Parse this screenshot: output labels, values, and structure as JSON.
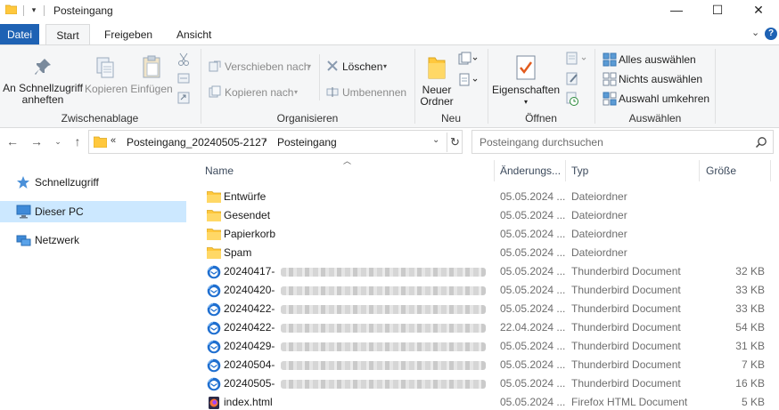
{
  "titlebar": {
    "title": "Posteingang",
    "qa_dropdown": "▾",
    "minimize": "—",
    "maximize": "☐",
    "close": "✕"
  },
  "tabs": [
    {
      "label": "Datei"
    },
    {
      "label": "Start"
    },
    {
      "label": "Freigeben"
    },
    {
      "label": "Ansicht"
    }
  ],
  "ribbon": {
    "groups": {
      "zwischenablage": "Zwischenablage",
      "organisieren": "Organisieren",
      "neu": "Neu",
      "oeffnen": "Öffnen",
      "auswaehlen": "Auswählen"
    },
    "pin_line1": "An Schnellzugriff",
    "pin_line2": "anheften",
    "copy": "Kopieren",
    "paste": "Einfügen",
    "move_to": "Verschieben nach",
    "copy_to": "Kopieren nach",
    "delete": "Löschen",
    "rename": "Umbenennen",
    "new_folder_line1": "Neuer",
    "new_folder_line2": "Ordner",
    "properties": "Eigenschaften",
    "select_all": "Alles auswählen",
    "select_none": "Nichts auswählen",
    "invert_selection": "Auswahl umkehren"
  },
  "address": {
    "overflow": "«",
    "crumbs": [
      "Posteingang_20240505-2127",
      "Posteingang"
    ],
    "separator": "›",
    "search_placeholder": "Posteingang durchsuchen"
  },
  "navpane": [
    {
      "label": "Schnellzugriff",
      "icon": "star-icon"
    },
    {
      "label": "Dieser PC",
      "icon": "computer-icon",
      "selected": true
    },
    {
      "label": "Netzwerk",
      "icon": "network-icon"
    }
  ],
  "columns": {
    "name": "Name",
    "date": "Änderungs...",
    "type": "Typ",
    "size": "Größe"
  },
  "files": [
    {
      "name": "Entwürfe",
      "date": "05.05.2024 ...",
      "type": "Dateiordner",
      "size": "",
      "icon": "folder-icon"
    },
    {
      "name": "Gesendet",
      "date": "05.05.2024 ...",
      "type": "Dateiordner",
      "size": "",
      "icon": "folder-icon"
    },
    {
      "name": "Papierkorb",
      "date": "05.05.2024 ...",
      "type": "Dateiordner",
      "size": "",
      "icon": "folder-icon"
    },
    {
      "name": "Spam",
      "date": "05.05.2024 ...",
      "type": "Dateiordner",
      "size": "",
      "icon": "folder-icon"
    },
    {
      "name": "20240417-",
      "date": "05.05.2024 ...",
      "type": "Thunderbird Document",
      "size": "32 KB",
      "icon": "thunderbird-icon",
      "blurred": true
    },
    {
      "name": "20240420-",
      "date": "05.05.2024 ...",
      "type": "Thunderbird Document",
      "size": "33 KB",
      "icon": "thunderbird-icon",
      "blurred": true
    },
    {
      "name": "20240422-",
      "date": "05.05.2024 ...",
      "type": "Thunderbird Document",
      "size": "33 KB",
      "icon": "thunderbird-icon",
      "blurred": true
    },
    {
      "name": "20240422-",
      "date": "22.04.2024 ...",
      "type": "Thunderbird Document",
      "size": "54 KB",
      "icon": "thunderbird-icon",
      "blurred": true
    },
    {
      "name": "20240429-",
      "date": "05.05.2024 ...",
      "type": "Thunderbird Document",
      "size": "31 KB",
      "icon": "thunderbird-icon",
      "blurred": true
    },
    {
      "name": "20240504-",
      "date": "05.05.2024 ...",
      "type": "Thunderbird Document",
      "size": "7 KB",
      "icon": "thunderbird-icon",
      "blurred": true
    },
    {
      "name": "20240505-",
      "date": "05.05.2024 ...",
      "type": "Thunderbird Document",
      "size": "16 KB",
      "icon": "thunderbird-icon",
      "blurred": true
    },
    {
      "name": "index.html",
      "date": "05.05.2024 ...",
      "type": "Firefox HTML Document",
      "size": "5 KB",
      "icon": "firefox-html-icon"
    }
  ],
  "colors": {
    "accent": "#1e62b4",
    "selection": "#cce8ff",
    "folder": "#ffc83d"
  }
}
